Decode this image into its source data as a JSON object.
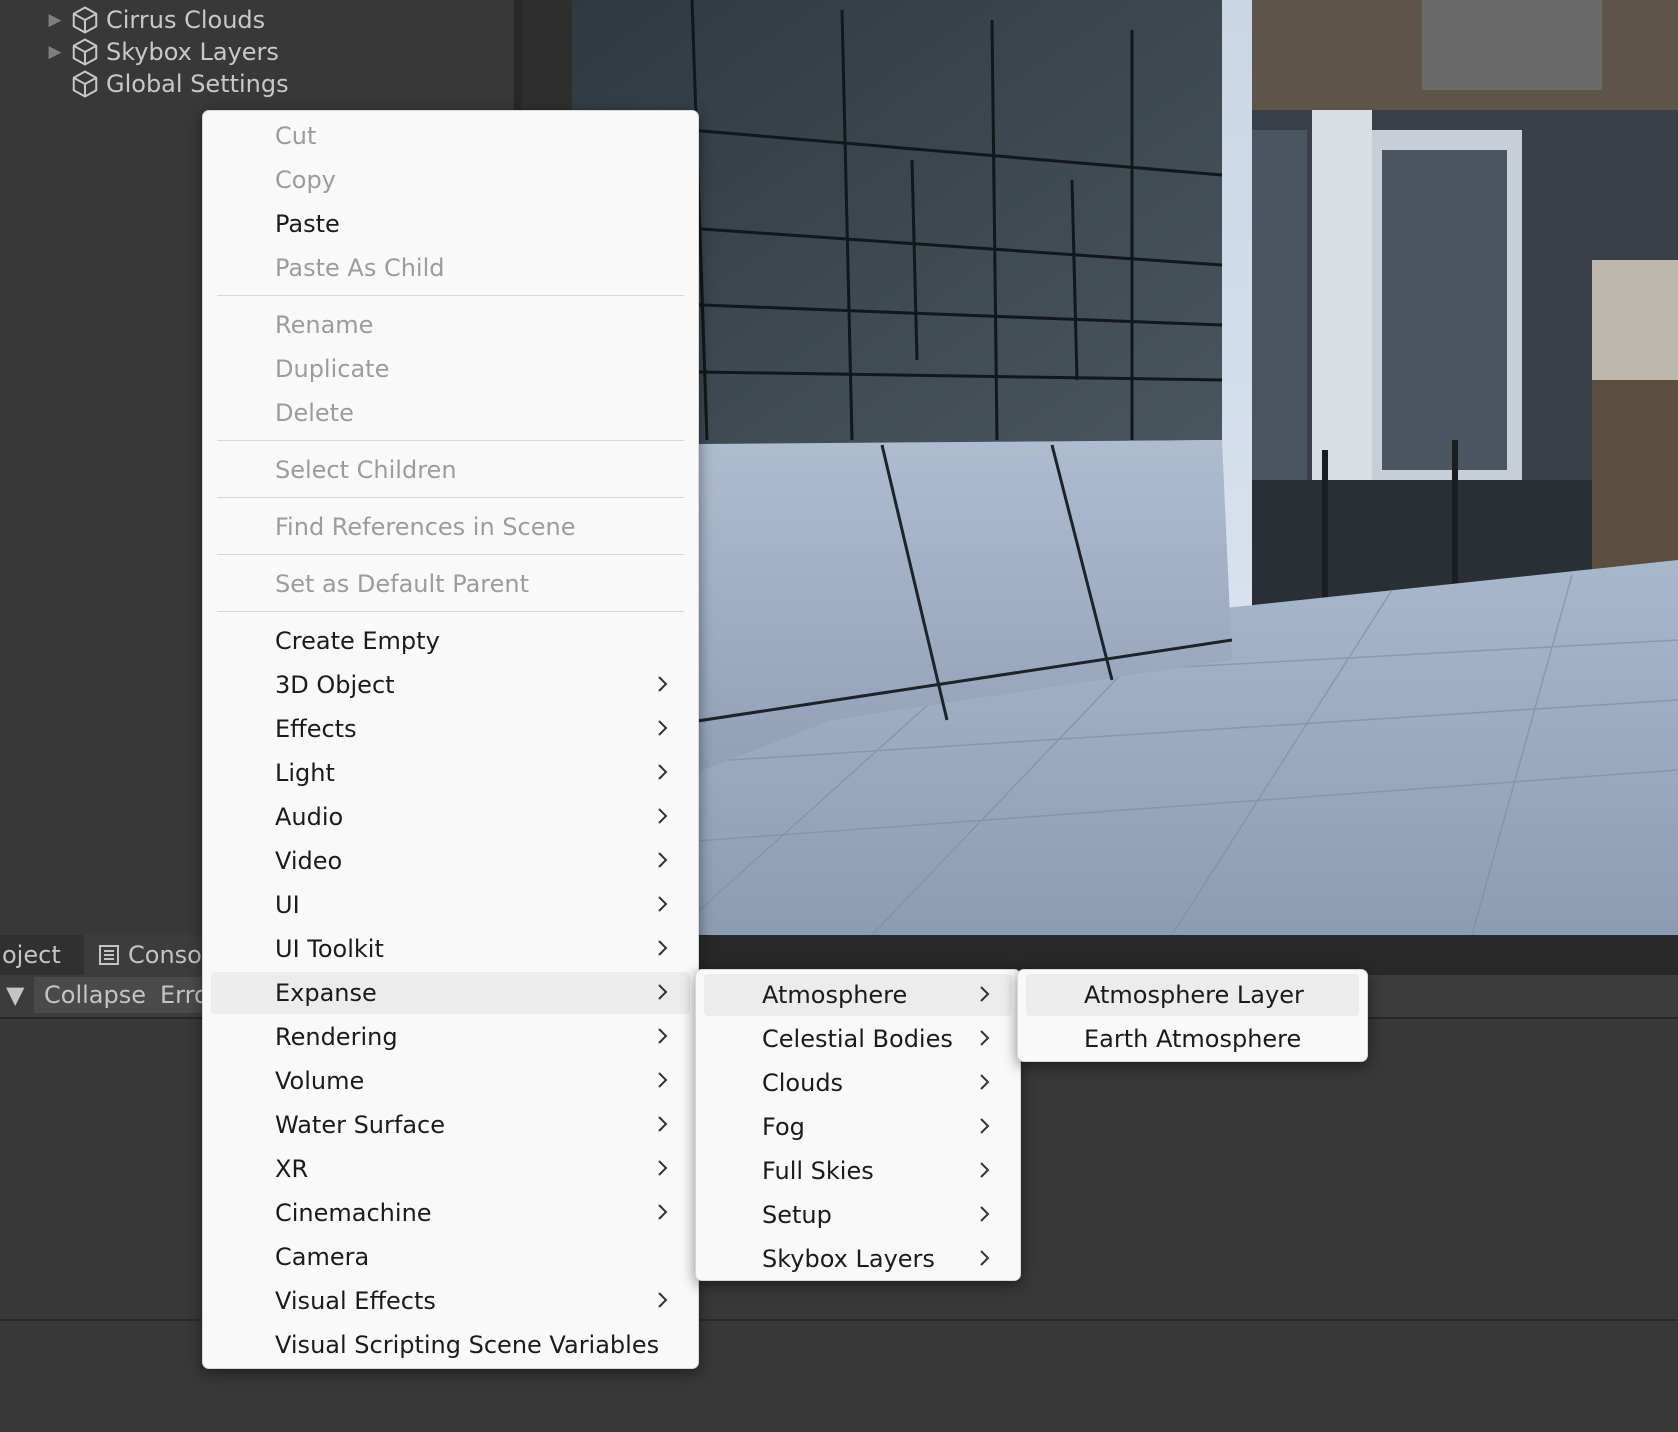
{
  "hierarchy": {
    "items": [
      {
        "label": "Cirrus Clouds",
        "expandable": true
      },
      {
        "label": "Skybox Layers",
        "expandable": true
      },
      {
        "label": "Global Settings",
        "expandable": false
      }
    ]
  },
  "bottom_panel": {
    "tabs": [
      "oject",
      "Conso"
    ],
    "toolbar": {
      "collapse_label": "Collapse",
      "error_label": "Erro"
    }
  },
  "context_menu": {
    "items": [
      {
        "label": "Cut",
        "enabled": false
      },
      {
        "label": "Copy",
        "enabled": false
      },
      {
        "label": "Paste",
        "enabled": true
      },
      {
        "label": "Paste As Child",
        "enabled": false
      },
      {
        "label": "Rename",
        "enabled": false
      },
      {
        "label": "Duplicate",
        "enabled": false
      },
      {
        "label": "Delete",
        "enabled": false
      },
      {
        "label": "Select Children",
        "enabled": false
      },
      {
        "label": "Find References in Scene",
        "enabled": false
      },
      {
        "label": "Set as Default Parent",
        "enabled": false
      },
      {
        "label": "Create Empty",
        "enabled": true
      },
      {
        "label": "3D Object",
        "enabled": true,
        "submenu": true
      },
      {
        "label": "Effects",
        "enabled": true,
        "submenu": true
      },
      {
        "label": "Light",
        "enabled": true,
        "submenu": true
      },
      {
        "label": "Audio",
        "enabled": true,
        "submenu": true
      },
      {
        "label": "Video",
        "enabled": true,
        "submenu": true
      },
      {
        "label": "UI",
        "enabled": true,
        "submenu": true
      },
      {
        "label": "UI Toolkit",
        "enabled": true,
        "submenu": true
      },
      {
        "label": "Expanse",
        "enabled": true,
        "submenu": true,
        "highlighted": true
      },
      {
        "label": "Rendering",
        "enabled": true,
        "submenu": true
      },
      {
        "label": "Volume",
        "enabled": true,
        "submenu": true
      },
      {
        "label": "Water Surface",
        "enabled": true,
        "submenu": true
      },
      {
        "label": "XR",
        "enabled": true,
        "submenu": true
      },
      {
        "label": "Cinemachine",
        "enabled": true,
        "submenu": true
      },
      {
        "label": "Camera",
        "enabled": true
      },
      {
        "label": "Visual Effects",
        "enabled": true,
        "submenu": true
      },
      {
        "label": "Visual Scripting Scene Variables",
        "enabled": true
      }
    ]
  },
  "expanse_submenu": {
    "items": [
      {
        "label": "Atmosphere",
        "submenu": true,
        "highlighted": true
      },
      {
        "label": "Celestial Bodies",
        "submenu": true
      },
      {
        "label": "Clouds",
        "submenu": true
      },
      {
        "label": "Fog",
        "submenu": true
      },
      {
        "label": "Full Skies",
        "submenu": true
      },
      {
        "label": "Setup",
        "submenu": true
      },
      {
        "label": "Skybox Layers",
        "submenu": true
      }
    ]
  },
  "atmosphere_submenu": {
    "items": [
      {
        "label": "Atmosphere Layer",
        "highlighted": true
      },
      {
        "label": "Earth Atmosphere"
      }
    ]
  },
  "icons": {
    "hierarchy_object": "cube-icon",
    "expand": "triangle-right-icon",
    "submenu": "chevron-right-icon",
    "console_tab": "console-icon",
    "dropdown": "triangle-down-icon"
  }
}
